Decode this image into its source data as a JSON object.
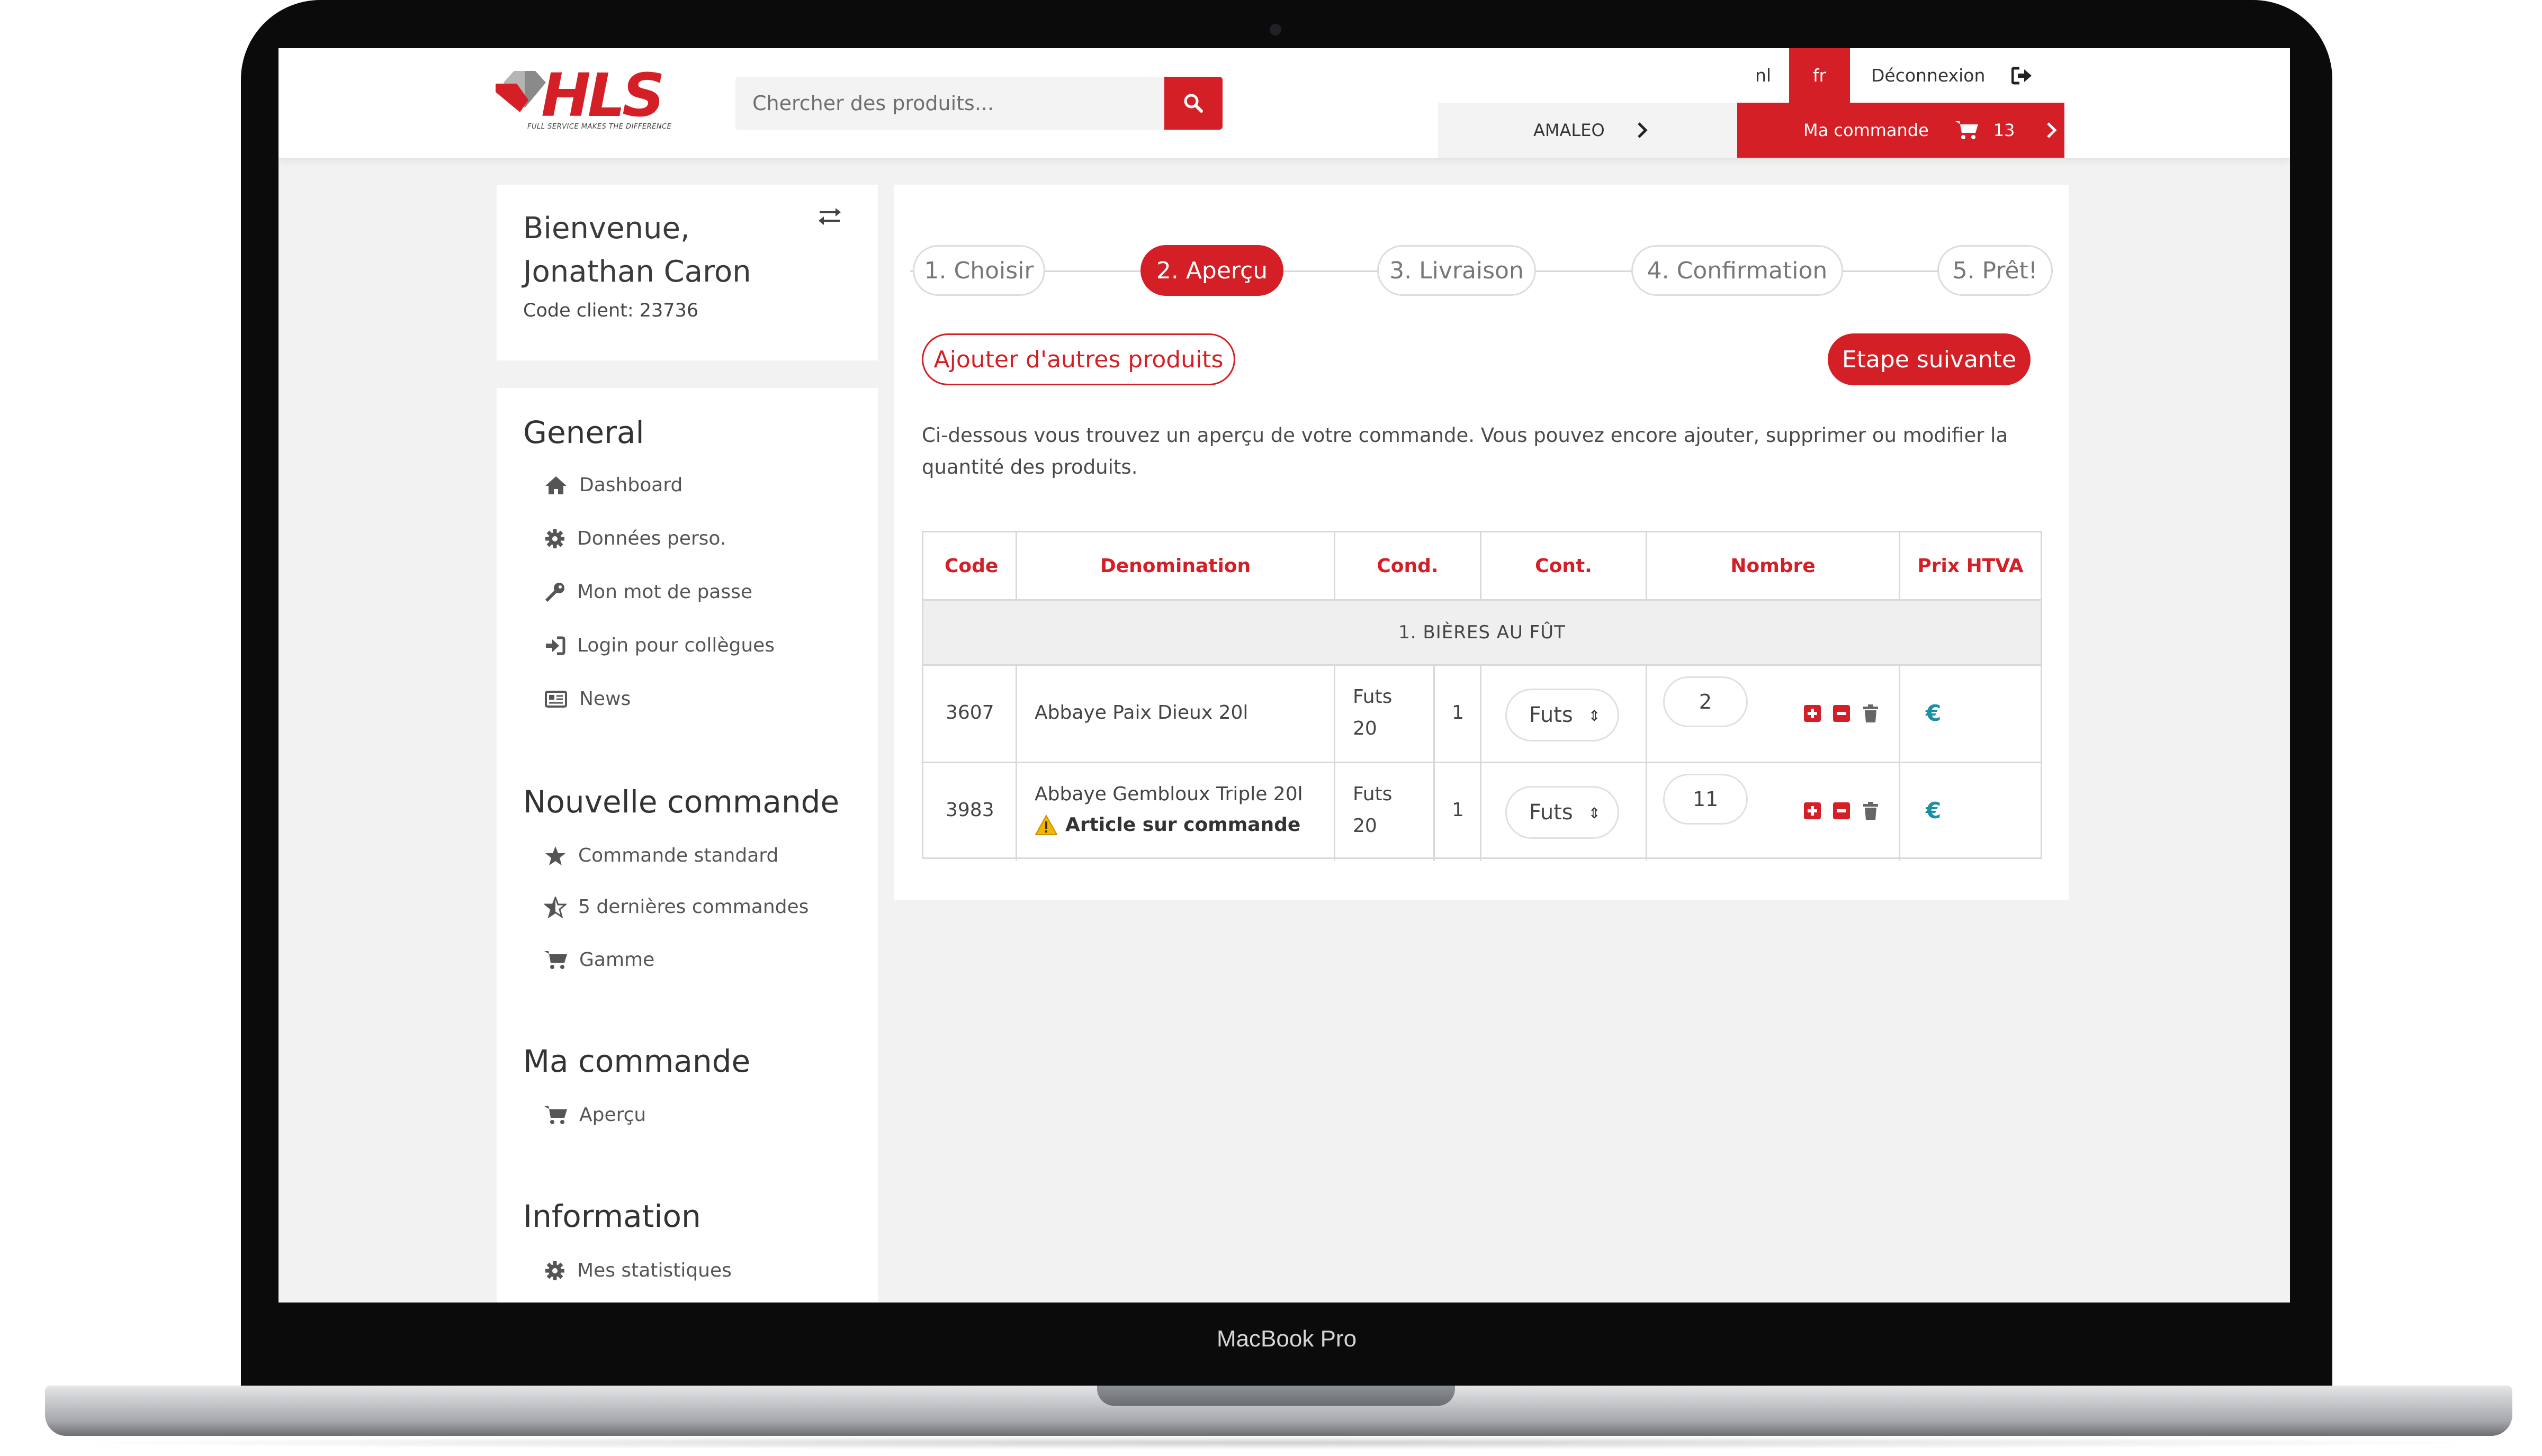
{
  "device": {
    "label": "MacBook Pro"
  },
  "header": {
    "logo_text": "HLS",
    "logo_tagline": "FULL SERVICE MAKES THE DIFFERENCE",
    "search_placeholder": "Chercher des produits...",
    "lang_nl": "nl",
    "lang_fr": "fr",
    "logout_label": "Déconnexion",
    "account_label": "AMALEO",
    "order_label": "Ma commande",
    "cart_count": "13",
    "accent_color": "#d51f26"
  },
  "user": {
    "welcome_line1": "Bienvenue,",
    "welcome_line2": "Jonathan Caron",
    "client_code": "Code client: 23736"
  },
  "sidebar": {
    "general_heading": "General",
    "general_items": [
      {
        "label": "Dashboard",
        "icon": "home-icon"
      },
      {
        "label": "Données perso.",
        "icon": "gear-icon"
      },
      {
        "label": "Mon mot de passe",
        "icon": "key-icon"
      },
      {
        "label": "Login pour collègues",
        "icon": "sign-in-icon"
      },
      {
        "label": "News",
        "icon": "newspaper-icon"
      }
    ],
    "new_order_heading": "Nouvelle commande",
    "new_order_items": [
      {
        "label": "Commande standard",
        "icon": "star-icon"
      },
      {
        "label": "5 dernières commandes",
        "icon": "half-star-icon"
      },
      {
        "label": "Gamme",
        "icon": "cart-icon"
      }
    ],
    "my_order_heading": "Ma commande",
    "my_order_items": [
      {
        "label": "Aperçu",
        "icon": "cart-icon"
      }
    ],
    "info_heading": "Information",
    "info_items": [
      {
        "label": "Mes statistiques",
        "icon": "gear-icon"
      }
    ]
  },
  "steps": [
    {
      "label": "1. Choisir",
      "active": false
    },
    {
      "label": "2. Aperçu",
      "active": true
    },
    {
      "label": "3. Livraison",
      "active": false
    },
    {
      "label": "4. Confirmation",
      "active": false
    },
    {
      "label": "5. Prêt!",
      "active": false
    }
  ],
  "actions": {
    "add_products": "Ajouter d'autres produits",
    "next_step": "Etape suivante"
  },
  "intro_line1": "Ci-dessous vous trouvez un aperçu de votre commande. Vous pouvez encore ajouter, supprimer ou modifier la",
  "intro_line2": "quantité des produits.",
  "table": {
    "headers": [
      "Code",
      "Denomination",
      "Cond.",
      "Cont.",
      "Nombre",
      "Prix HTVA"
    ],
    "group": "1. BIÈRES AU FÛT",
    "rows": [
      {
        "code": "3607",
        "name": "Abbaye Paix Dieux 20l",
        "note": "",
        "cond_unit": "Futs",
        "cond_size": "20",
        "cond_count": "1",
        "cont": "Futs",
        "qty": "2",
        "price": "€"
      },
      {
        "code": "3983",
        "name": "Abbaye Gembloux Triple 20l",
        "note": "Article sur commande",
        "cond_unit": "Futs",
        "cond_size": "20",
        "cond_count": "1",
        "cont": "Futs",
        "qty": "11",
        "price": "€"
      }
    ]
  }
}
